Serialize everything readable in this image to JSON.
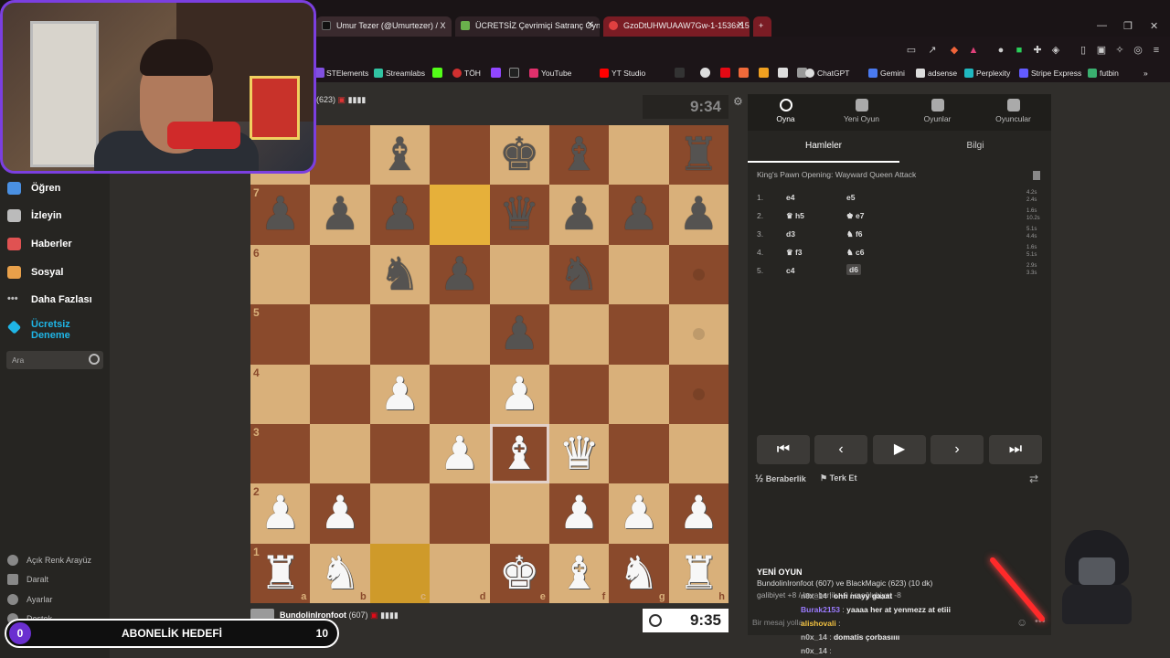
{
  "browser": {
    "tabs": [
      {
        "title": "Umur Tezer (@Umurtezer) / X",
        "color": "#1a1a1a"
      },
      {
        "title": "ÜCRETSİZ Çevrimiçi Satranç Oyn",
        "color": "#6ab04c"
      },
      {
        "title": "GzoDtUHWUAAW7Gw-1-1536x1536",
        "color": "#c0392b"
      }
    ],
    "new_tab": "+",
    "window_controls": [
      "—",
      "❐",
      "✕"
    ]
  },
  "bookmarks": [
    "STElements",
    "Streamlabs",
    "TÖH",
    "YouTube",
    "YT Studio",
    "ChatGPT",
    "Gemini",
    "adsense",
    "Perplexity",
    "Stripe Express",
    "futbin"
  ],
  "bookmark_more": "»",
  "sidebar": {
    "items": [
      {
        "label": "Öğren",
        "icon": "learn-icon",
        "color": "#4a90e2"
      },
      {
        "label": "İzleyin",
        "icon": "binoculars-icon",
        "color": "#bbbbbb"
      },
      {
        "label": "Haberler",
        "icon": "news-icon",
        "color": "#e05252"
      },
      {
        "label": "Sosyal",
        "icon": "social-icon",
        "color": "#e8a04a"
      },
      {
        "label": "Daha Fazlası",
        "icon": "more-icon",
        "color": "#bbbbbb"
      },
      {
        "label": "Ücretsiz Deneme",
        "icon": "diamond-icon",
        "color": "#1fb5e6"
      }
    ],
    "search_placeholder": "Ara",
    "bottom": [
      "Açık Renk Arayüz",
      "Daralt",
      "Ayarlar",
      "Destek"
    ]
  },
  "game": {
    "top_player": {
      "rating": "(623)"
    },
    "top_clock": "9:34",
    "bottom_player": {
      "name": "BundolinIronfoot",
      "rating": "(607)"
    },
    "bottom_clock": "9:35",
    "files": [
      "a",
      "b",
      "c",
      "d",
      "e",
      "f",
      "g",
      "h"
    ],
    "ranks": [
      "8",
      "7",
      "6",
      "5",
      "4",
      "3",
      "2",
      "1"
    ],
    "board": [
      [
        "",
        "",
        "b:♝",
        "",
        "b:♚",
        "b:♝",
        "",
        "b:♜"
      ],
      [
        "b:♟",
        "b:♟",
        "b:♟",
        "",
        "b:♛",
        "b:♟",
        "b:♟",
        "b:♟"
      ],
      [
        "",
        "",
        "b:♞",
        "b:♟",
        "",
        "b:♞",
        "",
        ""
      ],
      [
        "",
        "",
        "",
        "",
        "b:♟",
        "",
        "",
        ""
      ],
      [
        "",
        "",
        "w:♟",
        "",
        "w:♟",
        "",
        "",
        ""
      ],
      [
        "",
        "",
        "",
        "w:♟",
        "w:♝",
        "w:♛",
        "",
        ""
      ],
      [
        "w:♟",
        "w:♟",
        "",
        "",
        "",
        "w:♟",
        "w:♟",
        "w:♟"
      ],
      [
        "w:♜",
        "w:♞",
        "",
        "",
        "w:♚",
        "w:♝",
        "w:♞",
        "w:♜"
      ]
    ],
    "highlight": [
      [
        1,
        3
      ],
      [
        7,
        2
      ]
    ],
    "selected": [
      5,
      4
    ],
    "dots": [
      [
        2,
        7
      ],
      [
        3,
        7
      ],
      [
        4,
        7
      ],
      [
        3,
        4
      ]
    ]
  },
  "panel": {
    "tabs": [
      "Oyna",
      "Yeni Oyun",
      "Oyunlar",
      "Oyuncular"
    ],
    "subtabs": [
      "Hamleler",
      "Bilgi"
    ],
    "opening": "King's Pawn Opening: Wayward Queen Attack",
    "moves": [
      {
        "n": "1.",
        "w": "e4",
        "b": "e5",
        "tw": "4.2s",
        "tb": "2.4s"
      },
      {
        "n": "2.",
        "w": "♛ h5",
        "b": "♚ e7",
        "tw": "1.6s",
        "tb": "10.2s"
      },
      {
        "n": "3.",
        "w": "d3",
        "b": "♞ f6",
        "tw": "5.1s",
        "tb": "4.4s"
      },
      {
        "n": "4.",
        "w": "♛ f3",
        "b": "♞ c6",
        "tw": "1.6s",
        "tb": "5.1s"
      },
      {
        "n": "5.",
        "w": "c4",
        "b": "d6",
        "tw": "2.9s",
        "tb": "3.3s"
      }
    ],
    "nav": [
      "⏮",
      "‹",
      "▶",
      "›",
      "⏭"
    ],
    "draw": "Beraberlik",
    "resign": "Terk Et"
  },
  "chat": {
    "title": "YENİ OYUN",
    "game_line": "BundolinIronfoot (607) ve BlackMagic (623) (10 dk)",
    "result_line": "galibiyet +8 / beraberlik +0 / mağlubiyet -8",
    "messages": [
      {
        "user": "n0x_14",
        "text": "ohh mayy gaaat",
        "color": "#bbbbbb"
      },
      {
        "user": "Burak2153",
        "text": "yaaaa her at yenmezz at etiii",
        "color": "#9b7bff"
      },
      {
        "user": "alishovali",
        "text": "",
        "color": "#f0c040"
      },
      {
        "user": "n0x_14",
        "text": "domatis çorbasıııı",
        "color": "#bbbbbb"
      },
      {
        "user": "n0x_14",
        "text": "",
        "color": "#bbbbbb"
      }
    ],
    "input_placeholder": "Bir mesaj yolla..."
  },
  "overlay": {
    "sub_goal_label": "ABONELİK HEDEFİ",
    "sub_current": "0",
    "sub_goal": "10"
  }
}
